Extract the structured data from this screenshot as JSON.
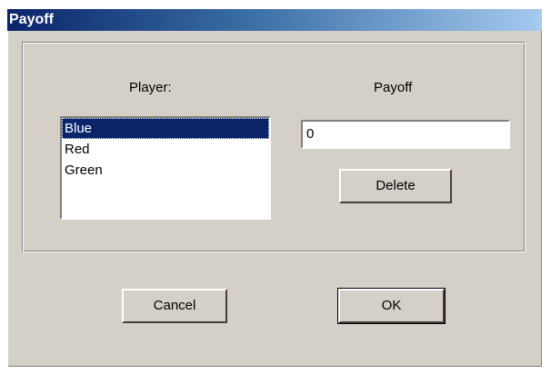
{
  "window": {
    "title": "Payoff"
  },
  "labels": {
    "player": "Player:",
    "payoff": "Payoff"
  },
  "players": [
    {
      "label": "Blue",
      "selected": true
    },
    {
      "label": "Red",
      "selected": false
    },
    {
      "label": "Green",
      "selected": false
    }
  ],
  "payoff_field": {
    "value": "0"
  },
  "buttons": {
    "delete": "Delete",
    "cancel": "Cancel",
    "ok": "OK"
  },
  "colors": {
    "title_gradient_start": "#0a246a",
    "title_gradient_end": "#a6caf0",
    "dialog_bg": "#d4d0c8",
    "selection": "#0a246a"
  }
}
